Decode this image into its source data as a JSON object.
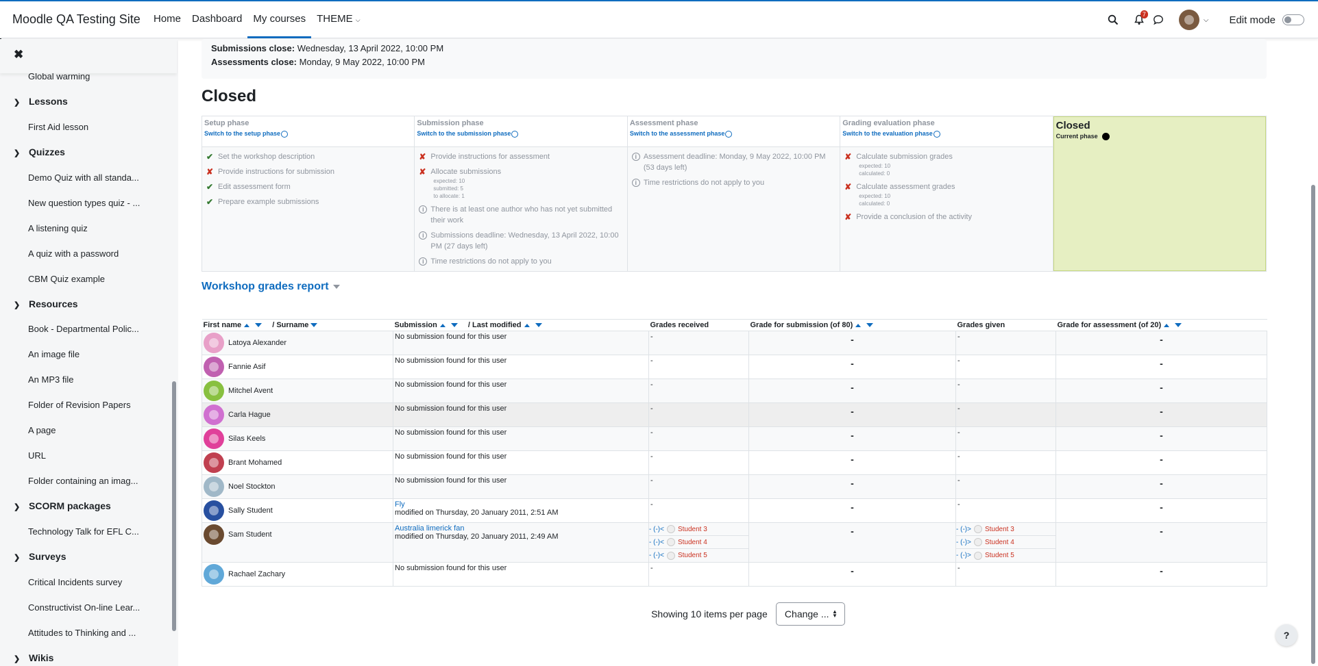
{
  "navbar": {
    "site_name": "Moodle QA Testing Site",
    "links": [
      "Home",
      "Dashboard",
      "My courses",
      "THEME"
    ],
    "active": "My courses",
    "notification_count": "7",
    "edit_mode_label": "Edit mode"
  },
  "drawer": {
    "close_icon": "✖",
    "first_item": "Global warming",
    "sections": [
      {
        "title": "Lessons",
        "items": [
          "First Aid lesson"
        ]
      },
      {
        "title": "Quizzes",
        "items": [
          "Demo Quiz with all standa...",
          "New question types quiz - ...",
          "A listening quiz",
          "A quiz with a password",
          "CBM Quiz example"
        ]
      },
      {
        "title": "Resources",
        "items": [
          "Book - Departmental Polic...",
          "An image file",
          "An MP3 file",
          "Folder of Revision Papers",
          "A page",
          "URL",
          "Folder containing an imag..."
        ]
      },
      {
        "title": "SCORM packages",
        "items": [
          "Technology Talk for EFL C..."
        ]
      },
      {
        "title": "Surveys",
        "items": [
          "Critical Incidents survey",
          "Constructivist On-line Lear...",
          "Attitudes to Thinking and ..."
        ]
      },
      {
        "title": "Wikis",
        "items": []
      }
    ]
  },
  "info": {
    "submissions_label": "Submissions close:",
    "submissions_value": "Wednesday, 13 April 2022, 10:00 PM",
    "assessments_label": "Assessments close:",
    "assessments_value": "Monday, 9 May 2022, 10:00 PM"
  },
  "heading": "Closed",
  "phases": {
    "setup": {
      "title": "Setup phase",
      "switch": "Switch to the setup phase",
      "tasks": [
        "Set the workshop description",
        "Provide instructions for submission",
        "Edit assessment form",
        "Prepare example submissions"
      ]
    },
    "submission": {
      "title": "Submission phase",
      "switch": "Switch to the submission phase",
      "task1": "Provide instructions for assessment",
      "task2": "Allocate submissions",
      "task2_sub": [
        "expected: 10",
        "submitted: 5",
        "to allocate: 1"
      ],
      "task3": "There is at least one author who has not yet submitted their work",
      "task4": "Submissions deadline: Wednesday, 13 April 2022, 10:00 PM (27 days left)",
      "task5": "Time restrictions do not apply to you"
    },
    "assessment": {
      "title": "Assessment phase",
      "switch": "Switch to the assessment phase",
      "task1": "Assessment deadline: Monday, 9 May 2022, 10:00 PM (53 days left)",
      "task2": "Time restrictions do not apply to you"
    },
    "evaluation": {
      "title": "Grading evaluation phase",
      "switch": "Switch to the evaluation phase",
      "task1": "Calculate submission grades",
      "task1_sub": [
        "expected: 10",
        "calculated: 0"
      ],
      "task2": "Calculate assessment grades",
      "task2_sub": [
        "expected: 10",
        "calculated: 0"
      ],
      "task3": "Provide a conclusion of the activity"
    },
    "closed": {
      "title": "Closed",
      "current": "Current phase"
    }
  },
  "report": {
    "title": "Workshop grades report",
    "headers": {
      "first_name": "First name",
      "surname": "/ Surname",
      "submission": "Submission",
      "last_modified": "/ Last modified",
      "grades_received": "Grades received",
      "grade_submission": "Grade for submission (of 80)",
      "grades_given": "Grades given",
      "grade_assessment": "Grade for assessment (of 20)"
    },
    "no_submission": "No submission found for this user",
    "dash": "-",
    "rows": [
      {
        "name": "Latoya Alexander",
        "color": "#e8a0c8"
      },
      {
        "name": "Fannie Asif",
        "color": "#c060b0"
      },
      {
        "name": "Mitchel Avent",
        "color": "#88c040"
      },
      {
        "name": "Carla Hague",
        "color": "#d070d0"
      },
      {
        "name": "Silas Keels",
        "color": "#e0409a"
      },
      {
        "name": "Brant Mohamed",
        "color": "#c04050"
      },
      {
        "name": "Noel Stockton",
        "color": "#a0b8c8"
      },
      {
        "name": "Sally Student",
        "color": "#2850a0",
        "submission": "Fly",
        "modified": "modified on Thursday, 20 January 2011, 2:51 AM"
      },
      {
        "name": "Sam Student",
        "color": "#6a4a30",
        "submission": "Australia limerick fan",
        "modified": "modified on Thursday, 20 January 2011, 2:49 AM"
      },
      {
        "name": "Rachael Zachary",
        "color": "#60a8d8"
      }
    ],
    "peer_prefix_received": "- (-)<",
    "peer_prefix_given": "- (-)>",
    "peers": [
      "Student 3",
      "Student 4",
      "Student 5"
    ]
  },
  "footer": {
    "showing": "Showing 10 items per page",
    "change": "Change ..."
  },
  "help": "?",
  "colors": {
    "brand": "#0f6cbf",
    "danger": "#ca3120",
    "success": "#357a32",
    "closed_bg": "#e6efc2"
  }
}
